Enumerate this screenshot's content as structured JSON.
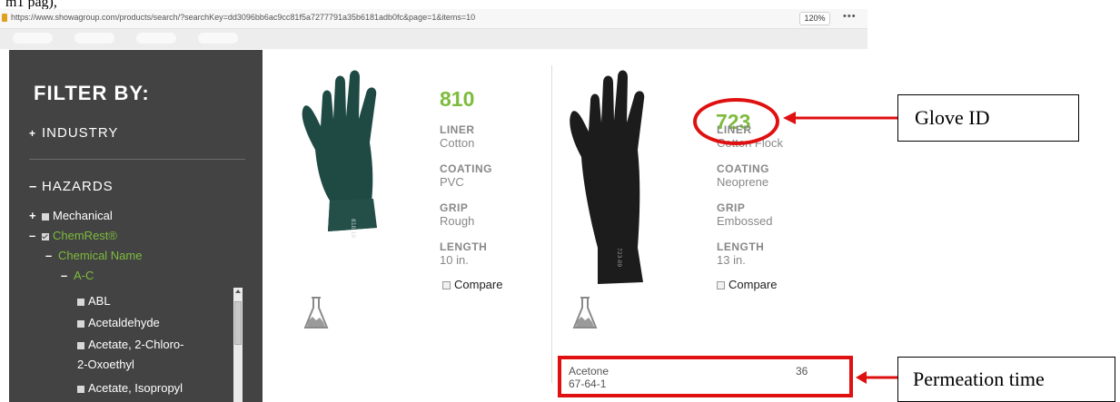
{
  "page": {
    "heading_fragment": "m1 pag),"
  },
  "browser": {
    "url": "https://www.showagroup.com/products/search/?searchKey=dd3096bb6ac9cc81f5a7277791a35b6181adb0fc&page=1&items=10",
    "zoom": "120%",
    "more_glyph": "•••"
  },
  "sidebar": {
    "title": "FILTER BY:",
    "industry": {
      "symbol": "+",
      "label": "INDUSTRY"
    },
    "hazards": {
      "symbol": "–",
      "label": "HAZARDS"
    },
    "items": [
      {
        "symbol": "+",
        "label": "Mechanical"
      },
      {
        "symbol": "–",
        "label": "ChemRest®"
      },
      {
        "symbol": "–",
        "label": "Chemical Name"
      },
      {
        "symbol": "–",
        "label": "A-C"
      },
      {
        "label": "ABL"
      },
      {
        "label": "Acetaldehyde"
      },
      {
        "label": "Acetate, 2-Chloro-"
      },
      {
        "label": "2-Oxoethyl"
      },
      {
        "label": "Acetate, Isopropyl"
      }
    ]
  },
  "products": [
    {
      "id": "810",
      "attributes": [
        {
          "label": "LINER",
          "value": "Cotton"
        },
        {
          "label": "COATING",
          "value": "PVC"
        },
        {
          "label": "GRIP",
          "value": "Rough"
        },
        {
          "label": "LENGTH",
          "value": "10 in."
        }
      ],
      "compare_label": "Compare",
      "glove_color": "#1f4a44",
      "cuff_print": "810-10"
    },
    {
      "id": "723",
      "attributes": [
        {
          "label": "LINER",
          "value": "Cotton Flock"
        },
        {
          "label": "COATING",
          "value": "Neoprene"
        },
        {
          "label": "GRIP",
          "value": "Embossed"
        },
        {
          "label": "LENGTH",
          "value": "13 in."
        }
      ],
      "compare_label": "Compare",
      "glove_color": "#1c1c1c",
      "cuff_print": "723-09"
    }
  ],
  "permeation": {
    "chemical": "Acetone",
    "cas": "67-64-1",
    "time": "36"
  },
  "annotations": {
    "glove_id_label": "Glove ID",
    "permeation_label": "Permeation time"
  },
  "colors": {
    "accent_green": "#7dbc3c",
    "annotation_red": "#e01010",
    "sidebar_bg": "#434343"
  },
  "icons": [
    "lock-icon",
    "more-options-icon",
    "glove-image",
    "flask-icon",
    "checkbox-icon",
    "arrow-icon"
  ]
}
